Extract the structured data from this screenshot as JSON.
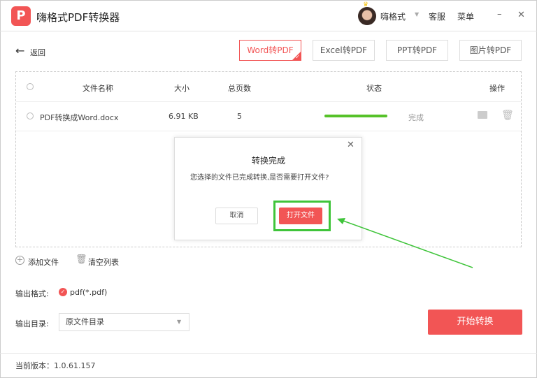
{
  "app": {
    "title": "嗨格式PDF转换器",
    "logo": "P",
    "user": "嗨格式",
    "service": "客服",
    "menu": "菜单",
    "minimize": "–",
    "close": "✕"
  },
  "nav": {
    "back": "返回",
    "tabs": [
      "Word转PDF",
      "Excel转PDF",
      "PPT转PDF",
      "图片转PDF"
    ],
    "active": 0
  },
  "table": {
    "headers": {
      "name": "文件名称",
      "size": "大小",
      "pages": "总页数",
      "status": "状态",
      "actions": "操作"
    },
    "rows": [
      {
        "name": "PDF转换成Word.docx",
        "size": "6.91 KB",
        "pages": "5",
        "progress": 100,
        "status": "完成"
      }
    ]
  },
  "dialog": {
    "title": "转换完成",
    "message": "您选择的文件已完成转换,是否需要打开文件?",
    "cancel": "取消",
    "open": "打开文件",
    "close": "✕"
  },
  "actions": {
    "add": "添加文件",
    "clear": "清空列表"
  },
  "output": {
    "format_label": "输出格式:",
    "format": "pdf(*.pdf)",
    "dir_label": "输出目录:",
    "dir": "原文件目录"
  },
  "start": "开始转换",
  "version": "当前版本：1.0.61.157",
  "colors": {
    "accent": "#f25555",
    "highlight": "#3fc43a"
  }
}
